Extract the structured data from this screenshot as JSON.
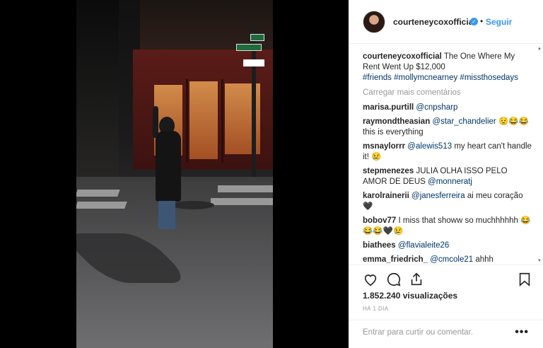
{
  "post": {
    "username": "courteneycoxofficial",
    "separator": "•",
    "follow_label": "Seguir",
    "caption_user": "courteneycoxofficial",
    "caption_text": "The One Where My Rent Went Up $12,000",
    "caption_tags": "#friends #mollymcnearney #missthosedays",
    "load_more_label": "Carregar mais comentários",
    "views": "1.852.240 visualizações",
    "time": "HÁ 1 DIA",
    "comment_placeholder": "Entrar para curtir ou comentar.",
    "more_options": "•••"
  },
  "comments": [
    {
      "user": "marisa.purtill",
      "mention": "@cnpsharp",
      "text": ""
    },
    {
      "user": "raymondtheasian",
      "mention": "@star_chandelier",
      "text": "😟😂😂 this is everything"
    },
    {
      "user": "msnaylorrr",
      "mention": "@alewis513",
      "text": "my heart can't handle it! 😢"
    },
    {
      "user": "stepmenezes",
      "mention": "",
      "text": "JULIA OLHA ISSO PELO AMOR DE DEUS",
      "trailing_mention": "@monneratj"
    },
    {
      "user": "karolrainerii",
      "mention": "@janesferreira",
      "text": "ai meu coração 🖤"
    },
    {
      "user": "bobov77",
      "mention": "",
      "text": "I miss that showw so muchhhhhh 😂😂😂🖤😢"
    },
    {
      "user": "biathees",
      "mention": "@flavialeite26",
      "text": ""
    },
    {
      "user": "emma_friedrich_",
      "mention": "@cmcole21",
      "text": "ahhh"
    }
  ],
  "colors": {
    "link": "#003569",
    "accent": "#3897f0",
    "muted": "#999999",
    "text": "#262626"
  },
  "icons": {
    "verified": "verified-badge-icon",
    "like": "heart-icon",
    "comment": "comment-bubble-icon",
    "share": "share-icon",
    "save": "bookmark-icon"
  }
}
